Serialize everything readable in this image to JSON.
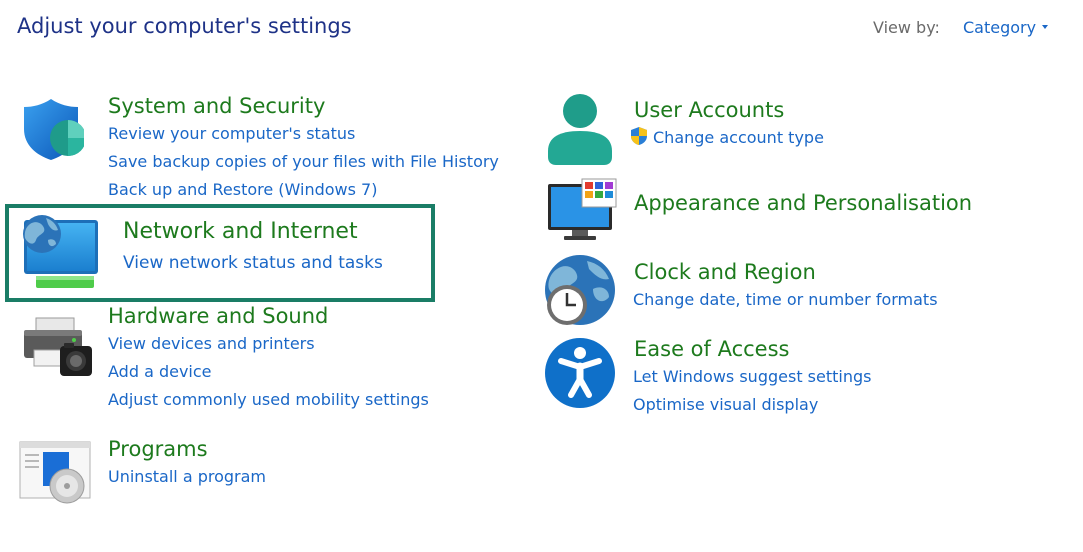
{
  "header": {
    "title": "Adjust your computer's settings",
    "view_by_label": "View by:",
    "view_by_value": "Category"
  },
  "categories": [
    {
      "title": "System and Security",
      "icon": "shield-icon",
      "links": [
        "Review your computer's status",
        "Save backup copies of your files with File History",
        "Back up and Restore (Windows 7)"
      ]
    },
    {
      "title": "Network and Internet",
      "icon": "network-icon",
      "links": [
        "View network status and tasks"
      ]
    },
    {
      "title": "Hardware and Sound",
      "icon": "printer-icon",
      "links": [
        "View devices and printers",
        "Add a device",
        "Adjust commonly used mobility settings"
      ]
    },
    {
      "title": "Programs",
      "icon": "programs-icon",
      "links": [
        "Uninstall a program"
      ]
    },
    {
      "title": "User Accounts",
      "icon": "user-icon",
      "links": [
        "Change account type"
      ]
    },
    {
      "title": "Appearance and Personalisation",
      "icon": "monitor-icon",
      "links": []
    },
    {
      "title": "Clock and Region",
      "icon": "clock-globe-icon",
      "links": [
        "Change date, time or number formats"
      ]
    },
    {
      "title": "Ease of Access",
      "icon": "accessibility-icon",
      "links": [
        "Let Windows suggest settings",
        "Optimise visual display"
      ]
    }
  ],
  "colors": {
    "title": "#1e3287",
    "category": "#1d7a1d",
    "link": "#1a67c7",
    "highlight": "#1a7d66"
  }
}
